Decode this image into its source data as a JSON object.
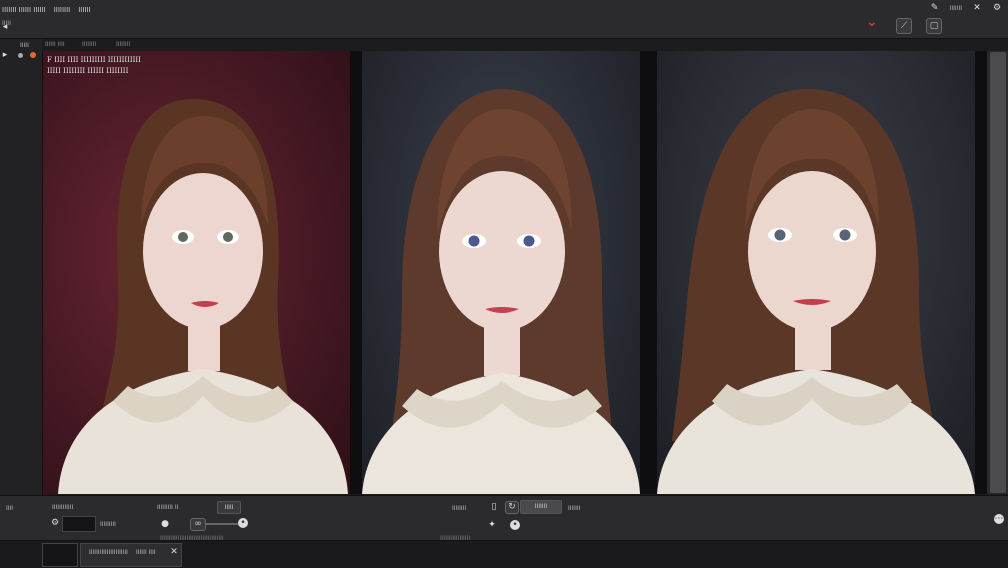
{
  "topbar": {
    "menu": [
      "IIIIIII IIIIII IIIIII",
      "IIIIIIII",
      "IIIIII"
    ],
    "sub": [
      "IIIII"
    ],
    "right_icons": [
      "pen-icon",
      "close-icon",
      "settings-icon"
    ],
    "tools": [
      "chevron-down-icon",
      "brush-icon",
      "frame-icon"
    ]
  },
  "header": {
    "label1": "IIIIII IIII",
    "label2": "IIIIIIII",
    "label3": "IIIIIIII"
  },
  "overlay": {
    "line1": "F IIII IIII IIIIIIIII IIIIIIIIIIII",
    "line2": "IIIII IIIIIIII IIIIII IIIIIIII"
  },
  "panels": [
    {
      "name": "image-panel-1",
      "bg": "#4a1a25"
    },
    {
      "name": "image-panel-2",
      "bg": "#2a2d36"
    },
    {
      "name": "image-panel-3",
      "bg": "#2a2c34"
    }
  ],
  "bottom": {
    "label_left": "IIIIIIIIIIII",
    "label_mid": "IIIIIIIII II",
    "field_mid": "IIIII",
    "field_left": "IIIIIIIII",
    "label_center": "IIIIIIII",
    "button_center": "IIIIIII",
    "label_right": "IIIIIII",
    "status_left": "IIIIIIIIIIIIIIIIIIIIIIIIIIIIIIIIIIII",
    "status_center": "IIIIIIIIIIIIIIIII",
    "tab1": "IIIIIIIIIIIIIIIIIIIIII",
    "tab2": "IIIIII IIII"
  }
}
